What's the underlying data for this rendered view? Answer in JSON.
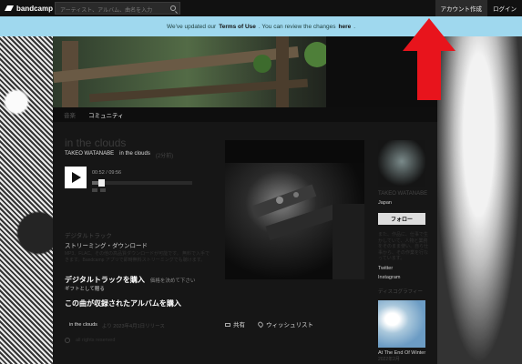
{
  "topbar": {
    "logo_text": "bandcamp",
    "search_placeholder": "アーティスト、アルバム、曲名を入力",
    "signup_label": "アカウント作成",
    "login_label": "ログイン"
  },
  "notice": {
    "prefix": "We've updated our",
    "terms": "Terms of Use",
    "middle": ". You can review the changes",
    "here": "here",
    "suffix": "."
  },
  "nav": {
    "items": [
      {
        "label": "音楽",
        "active": false
      },
      {
        "label": "コミュニティ",
        "active": true
      }
    ]
  },
  "track": {
    "title": "in the clouds",
    "artist": "TAKEO WATANABE",
    "from": "in the clouds",
    "date": "(2分前)",
    "time": "00:52 / 09:56",
    "progress": 0.09
  },
  "purchase": {
    "format_heading": "デジタルトラック",
    "format_sub": "ストリーミング・ダウンロード",
    "description": "MP3、FLAC、その他の高品質ダウンロードが可能です。 無料で入手できます。Bandcamp アプリで即時無料ストリーミングでも聴けます。",
    "buy_track_label": "デジタルトラックを購入",
    "buy_track_note": "価格を決めて下さい",
    "gift_label": "ギフトとして贈る",
    "buy_album_label": "この曲が収録されたアルバムを購入"
  },
  "release": {
    "title": "in the clouds",
    "date": "より 2023年4月1日リリース"
  },
  "rights": {
    "text": "all rights reserved"
  },
  "share": {
    "share_label": "共有",
    "wishlist_label": "ウィッシュリスト"
  },
  "sidebar": {
    "artist": "TAKEO WATANABE",
    "location": "Japan",
    "follow_label": "フォロー",
    "bio": "また、作品に、仕事で生かしていて、人物と業務をそのまま使い、自ら仕事から、その作業を行なっています。",
    "twitter": "Twitter",
    "instagram": "Instagram",
    "discography_heading": "ディスコグラフィー",
    "release_title": "At The End Of Winter",
    "release_date": "2022年2月"
  },
  "colors": {
    "notice_bg": "#9fd8ee",
    "arrow_red": "#e8141c",
    "page_bg": "#161616"
  },
  "icons": [
    "search-icon",
    "play-icon",
    "share-icon",
    "heart-icon",
    "cc-icon"
  ]
}
